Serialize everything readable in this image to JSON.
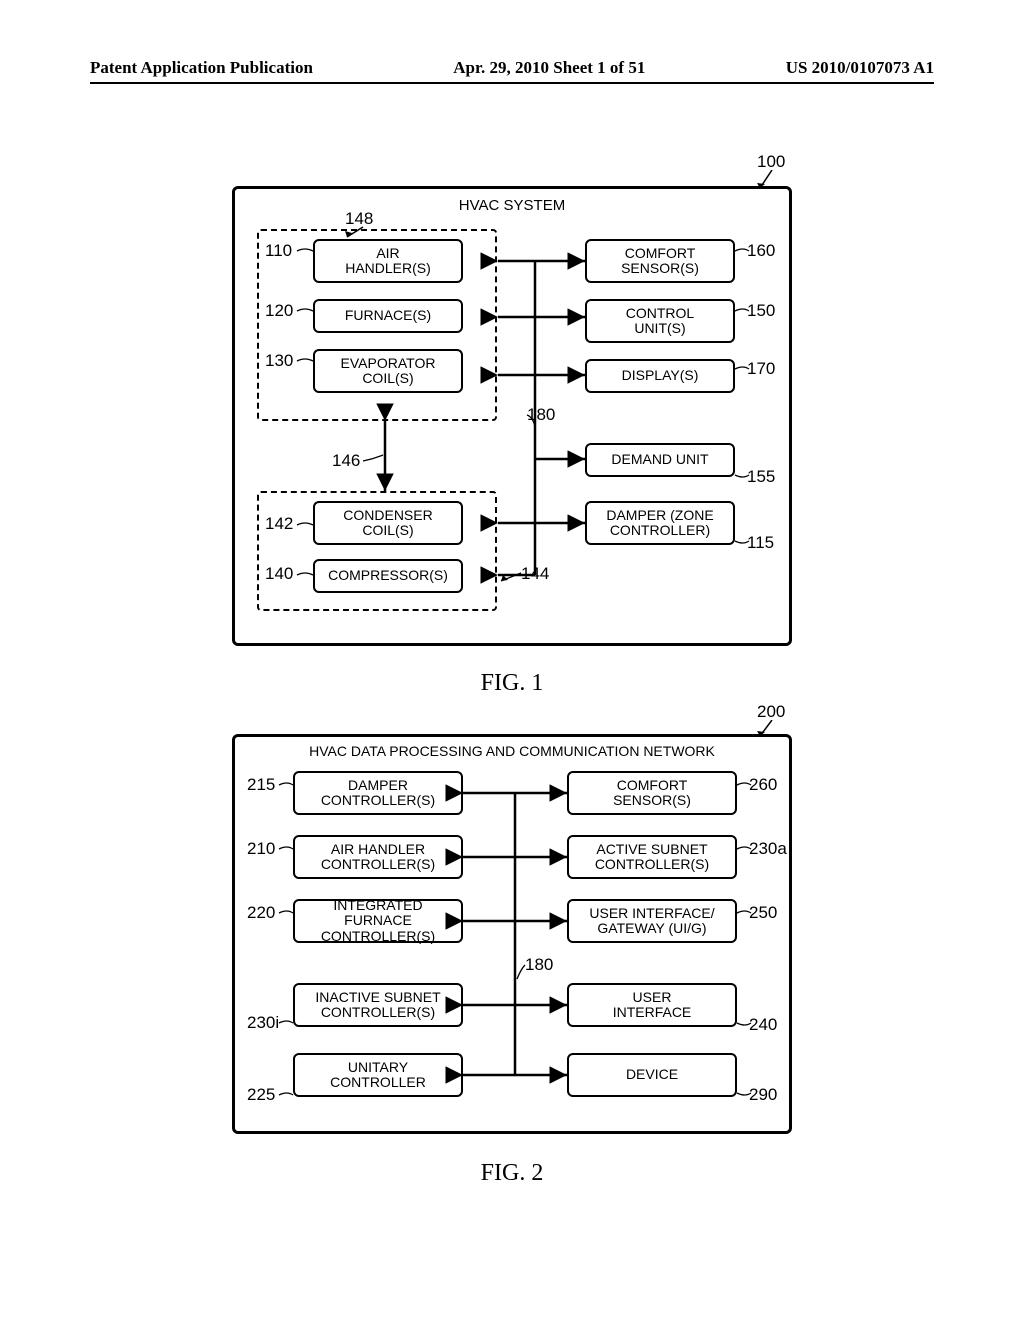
{
  "header": {
    "left": "Patent Application Publication",
    "center": "Apr. 29, 2010  Sheet 1 of 51",
    "right": "US 2010/0107073 A1"
  },
  "fig1": {
    "caption": "FIG. 1",
    "ref_main": "100",
    "title": "HVAC SYSTEM",
    "refs": {
      "r148": "148",
      "r110": "110",
      "r120": "120",
      "r130": "130",
      "r146": "146",
      "r142": "142",
      "r140": "140",
      "r160": "160",
      "r150": "150",
      "r170": "170",
      "r180": "180",
      "r155": "155",
      "r115": "115",
      "r144": "144"
    },
    "boxes": {
      "air_handler": "AIR\nHANDLER(S)",
      "furnaces": "FURNACE(S)",
      "evap": "EVAPORATOR\nCOIL(S)",
      "cond": "CONDENSER\nCOIL(S)",
      "comp": "COMPRESSOR(S)",
      "comfort": "COMFORT\nSENSOR(S)",
      "control": "CONTROL\nUNIT(S)",
      "display": "DISPLAY(S)",
      "demand": "DEMAND UNIT",
      "damper": "DAMPER (ZONE\nCONTROLLER)"
    }
  },
  "fig2": {
    "caption": "FIG. 2",
    "ref_main": "200",
    "title": "HVAC DATA PROCESSING AND COMMUNICATION NETWORK",
    "refs": {
      "r215": "215",
      "r210": "210",
      "r220": "220",
      "r230i": "230i",
      "r225": "225",
      "r260": "260",
      "r230a": "230a",
      "r250": "250",
      "r180": "180",
      "r240": "240",
      "r290": "290"
    },
    "boxes": {
      "damper_ctl": "DAMPER\nCONTROLLER(S)",
      "ah_ctl": "AIR HANDLER\nCONTROLLER(S)",
      "if_ctl": "INTEGRATED FURNACE\nCONTROLLER(S)",
      "inactive": "INACTIVE SUBNET\nCONTROLLER(S)",
      "unitary": "UNITARY\nCONTROLLER",
      "comfort": "COMFORT\nSENSOR(S)",
      "active": "ACTIVE SUBNET\nCONTROLLER(S)",
      "uig": "USER INTERFACE/\nGATEWAY (UI/G)",
      "ui": "USER\nINTERFACE",
      "device": "DEVICE"
    }
  }
}
